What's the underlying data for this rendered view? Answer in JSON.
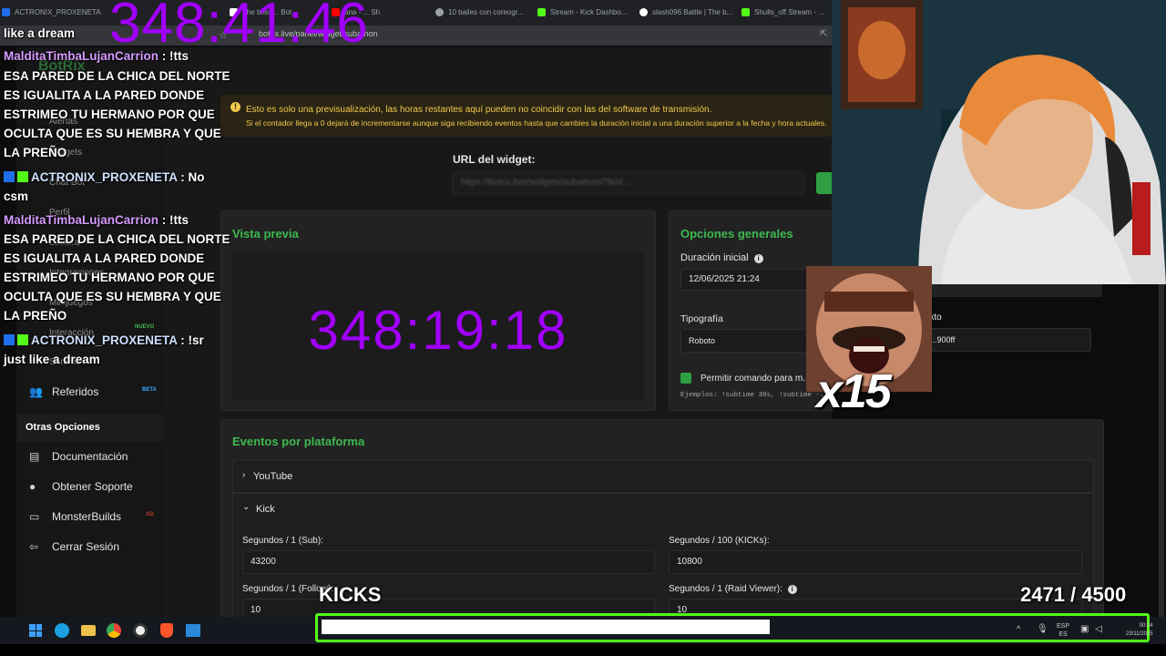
{
  "browser": {
    "tabs": [
      {
        "title": "ACTRONIX_PROXENETA",
        "color": "#1f6feb"
      },
      {
        "title": "The best ... Bot",
        "color": "#ffffff"
      },
      {
        "title": "ana - ... Sh",
        "color": "#ff0000"
      },
      {
        "title": "10 bailes con coreogr...",
        "color": "#9aa0a6"
      },
      {
        "title": "Stream - Kick Dashbo...",
        "color": "#53fc18"
      },
      {
        "title": "slash096 Battle | The b...",
        "color": "#ffffff"
      },
      {
        "title": "Shulls_off Stream - ...",
        "color": "#53fc18"
      }
    ],
    "url": "botrix.live/panel/widget/subathon"
  },
  "overlay": {
    "top_timer": "348:41:46",
    "kicks_label": "KICKS",
    "kicks_progress": "2471 / 4500",
    "kicks_current": 2471,
    "kicks_goal": 4500,
    "multiplier": "x15"
  },
  "chat": [
    {
      "user": "",
      "text": "like a dream"
    },
    {
      "user": "MalditaTimbaLujanCarrion",
      "sep": " : ",
      "text": "!tts"
    },
    {
      "text": "ESA PARED DE LA CHICA DEL NORTE"
    },
    {
      "text": "ES IGUALITA A LA PARED DONDE"
    },
    {
      "text": "ESTRIMEO TU HERMANO POR QUE"
    },
    {
      "text": "OCULTA QUE ES SU HEMBRA Y QUE"
    },
    {
      "text": "LA PREÑO"
    },
    {
      "user": "ACTRONIX_PROXENETA",
      "sep": " : ",
      "text": "No"
    },
    {
      "text": "csm"
    },
    {
      "user": "MalditaTimbaLujanCarrion",
      "sep": " : ",
      "text": "!tts"
    },
    {
      "text": "ESA PARED DE LA CHICA DEL NORTE"
    },
    {
      "text": "ES IGUALITA A LA PARED DONDE"
    },
    {
      "text": "ESTRIMEO TU HERMANO POR QUE"
    },
    {
      "text": "OCULTA QUE ES SU HEMBRA Y QUE"
    },
    {
      "text": "LA PREÑO"
    },
    {
      "user": "ACTRONIX_PROXENETA",
      "sep": " : ",
      "text": "!sr"
    },
    {
      "text": "just like a dream"
    }
  ],
  "sidebar": {
    "logo": "BotRix",
    "ghost_items": [
      "Alertas",
      "Widgets",
      "Chat Bot",
      "Perfil",
      "Lectura",
      "Integraciones",
      "Minijuegos",
      "Interacción",
      "Sorteos"
    ],
    "nuevo_badge": "NUEVO",
    "referidos": {
      "label": "Referidos",
      "badge": "BETA"
    },
    "section_title": "Otras Opciones",
    "items": [
      {
        "label": "Documentación",
        "icon": "document-icon"
      },
      {
        "label": "Obtener Soporte",
        "icon": "support-icon"
      },
      {
        "label": "MonsterBuilds",
        "icon": "monitor-icon",
        "badge": "AD"
      },
      {
        "label": "Cerrar Sesión",
        "icon": "logout-icon"
      }
    ]
  },
  "notice": {
    "line1": "Esto es solo una previsualización, las horas restantes aquí pueden no coincidir con las del software de transmisión.",
    "line2": "Si el contador llega a 0 dejará de incrementarse aunque siga recibiendo eventos hasta que cambies la duración inicial a una duración superior a la fecha y hora actuales."
  },
  "widget_url": {
    "label": "URL del widget:",
    "value": "https://botrix.live/widgets/subathon/7bd4 ... "
  },
  "preview": {
    "title": "Vista previa",
    "timer": "348:19:18",
    "timer_color": "#a100ff"
  },
  "options": {
    "title": "Opciones generales",
    "duration_label": "Duración inicial",
    "duration_value": "12/06/2025 21:24",
    "font_label": "Tipografía",
    "font_value": "Roboto",
    "text_label": "...xto",
    "text_value": "...900ff",
    "allow_label": "Permitir comando para m...",
    "examples": "Ejemplos:  !subtime 30s,  !subtime -..."
  },
  "events": {
    "title": "Eventos por plataforma",
    "youtube": "YouTube",
    "kick": "Kick",
    "fields": [
      {
        "label": "Segundos / 1 (Sub):",
        "value": "43200"
      },
      {
        "label": "Segundos / 100 (KICKs):",
        "value": "10800"
      },
      {
        "label": "Segundos / 1 (Follow):",
        "value": "10"
      },
      {
        "label": "Segundos / 1 (Raid Viewer):",
        "value": "10"
      }
    ]
  },
  "taskbar": {
    "lang": "ESP",
    "region": "ES",
    "time": "00:04",
    "date": "23/11/2025"
  },
  "colors": {
    "accent_green": "#3fb950",
    "timer_purple": "#a100ff",
    "kicks_bar_border": "#53fc18"
  }
}
